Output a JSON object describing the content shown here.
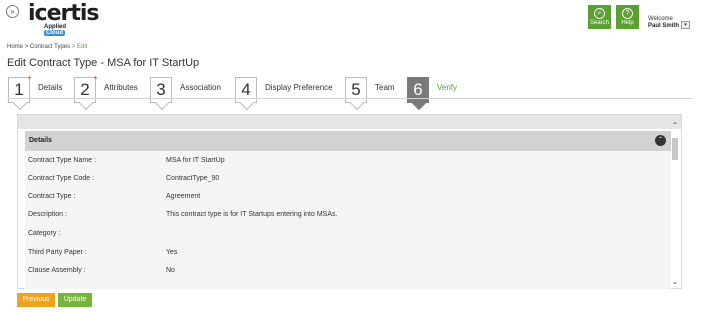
{
  "header": {
    "collapse_icon": "chevron-double-down-icon",
    "logo_text": "icertis",
    "logo_sub": "Applied",
    "logo_cloud": "Cloud",
    "search_label": "Search",
    "help_label": "Help",
    "welcome": "Welcome",
    "username": "Paul Smith",
    "accent": "#5aa132"
  },
  "breadcrumb": {
    "home": "Home",
    "sep": ">",
    "contract_types": "Contract Types",
    "edit": "Edit"
  },
  "page_title": "Edit Contract Type - MSA for IT StartUp",
  "steps": [
    {
      "num": "1",
      "label": "Details",
      "required": "*"
    },
    {
      "num": "2",
      "label": "Attributes",
      "required": "*"
    },
    {
      "num": "3",
      "label": "Association"
    },
    {
      "num": "4",
      "label": "Display Preference"
    },
    {
      "num": "5",
      "label": "Team"
    },
    {
      "num": "6",
      "label": "Verify"
    }
  ],
  "section": {
    "title": "Details",
    "rows": [
      {
        "label": "Contract Type Name :",
        "value": "MSA for IT StartUp"
      },
      {
        "label": "Contract Type Code :",
        "value": "ContractType_90"
      },
      {
        "label": "Contract Type :",
        "value": "Agreement"
      },
      {
        "label": "Description :",
        "value": "This contract type is for IT Startups entering into MSAs."
      },
      {
        "label": "Category :",
        "value": ""
      },
      {
        "label": "Third Party Paper :",
        "value": "Yes"
      },
      {
        "label": "Clause Assembly :",
        "value": "No"
      }
    ]
  },
  "buttons": {
    "previous": "Previous",
    "update": "Update"
  },
  "colors": {
    "previous": "#f0a319",
    "update": "#76b43b",
    "active_step": "#7a7a7a"
  }
}
